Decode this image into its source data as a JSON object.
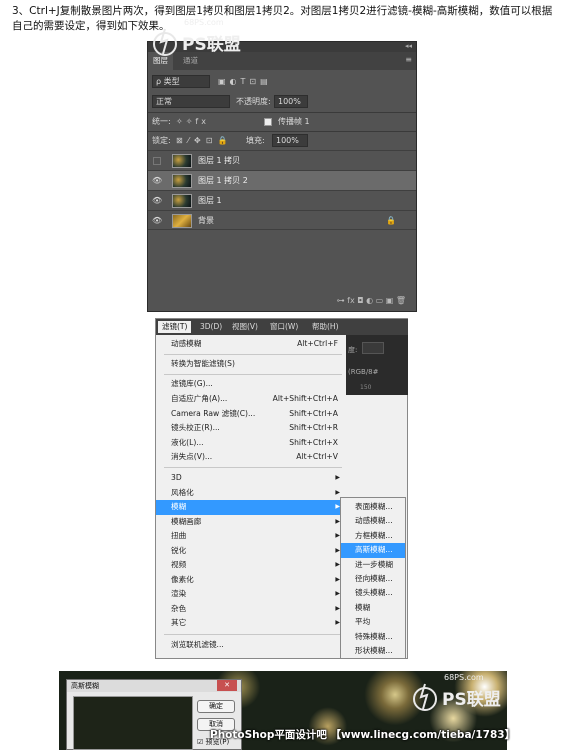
{
  "intro": "3、Ctrl+J复制散景图片两次，得到图层1拷贝和图层1拷贝2。对图层1拷贝2进行滤镜-模糊-高斯模糊，数值可以根据自己的需要设定，得到如下效果。",
  "layers_panel": {
    "tabs": [
      "图层",
      "通道"
    ],
    "kind_label": "ρ 类型",
    "blend_mode": "正常",
    "opacity_label": "不透明度:",
    "opacity_value": "100%",
    "unify_label": "统一:",
    "propagate_label": "传播帧 1",
    "lock_label": "锁定:",
    "fill_label": "填充:",
    "fill_value": "100%",
    "layers": [
      {
        "name": "图层 1 拷贝",
        "visible": false
      },
      {
        "name": "图层 1 拷贝 2",
        "visible": true,
        "selected": true
      },
      {
        "name": "图层 1",
        "visible": true
      },
      {
        "name": "背景",
        "visible": true,
        "locked": true
      }
    ],
    "bottom_icons": "⊶  fx  ◘  ◐  ▭  ▣  🗑"
  },
  "watermark": {
    "site": "68PS.com",
    "brand": "PS联盟"
  },
  "filter_menu": {
    "menubar": [
      "滤镜(T)",
      "3D(D)",
      "视图(V)",
      "窗口(W)",
      "帮助(H)"
    ],
    "items": [
      {
        "label": "动感模糊",
        "shortcut": "Alt+Ctrl+F"
      },
      {
        "label": "转换为智能滤镜(S)",
        "shortcut": ""
      },
      {
        "label": "滤镜库(G)...",
        "shortcut": ""
      },
      {
        "label": "自适应广角(A)...",
        "shortcut": "Alt+Shift+Ctrl+A"
      },
      {
        "label": "Camera Raw 滤镜(C)...",
        "shortcut": "Shift+Ctrl+A"
      },
      {
        "label": "镜头校正(R)...",
        "shortcut": "Shift+Ctrl+R"
      },
      {
        "label": "液化(L)...",
        "shortcut": "Shift+Ctrl+X"
      },
      {
        "label": "消失点(V)...",
        "shortcut": "Alt+Ctrl+V"
      },
      {
        "label": "3D",
        "submenu": true
      },
      {
        "label": "风格化",
        "submenu": true
      },
      {
        "label": "模糊",
        "submenu": true
      },
      {
        "label": "模糊画廊",
        "submenu": true
      },
      {
        "label": "扭曲",
        "submenu": true
      },
      {
        "label": "锐化",
        "submenu": true
      },
      {
        "label": "视频",
        "submenu": true
      },
      {
        "label": "像素化",
        "submenu": true
      },
      {
        "label": "渲染",
        "submenu": true
      },
      {
        "label": "杂色",
        "submenu": true
      },
      {
        "label": "其它",
        "submenu": true
      },
      {
        "label": "浏览联机滤镜...",
        "shortcut": ""
      }
    ],
    "ps_strip": [
      "度:",
      "(RGB/8#",
      "150"
    ]
  },
  "blur_submenu": [
    "表面模糊...",
    "动感模糊...",
    "方框模糊...",
    "高斯模糊...",
    "进一步模糊",
    "径向模糊...",
    "镜头模糊...",
    "模糊",
    "平均",
    "特殊模糊...",
    "形状模糊..."
  ],
  "gauss_dialog": {
    "title": "高斯模糊",
    "ok": "确定",
    "cancel": "取消",
    "preview": "预览(P)"
  },
  "footer": "PhotoShop平面设计吧 【www.linecg.com/tieba/1783】"
}
